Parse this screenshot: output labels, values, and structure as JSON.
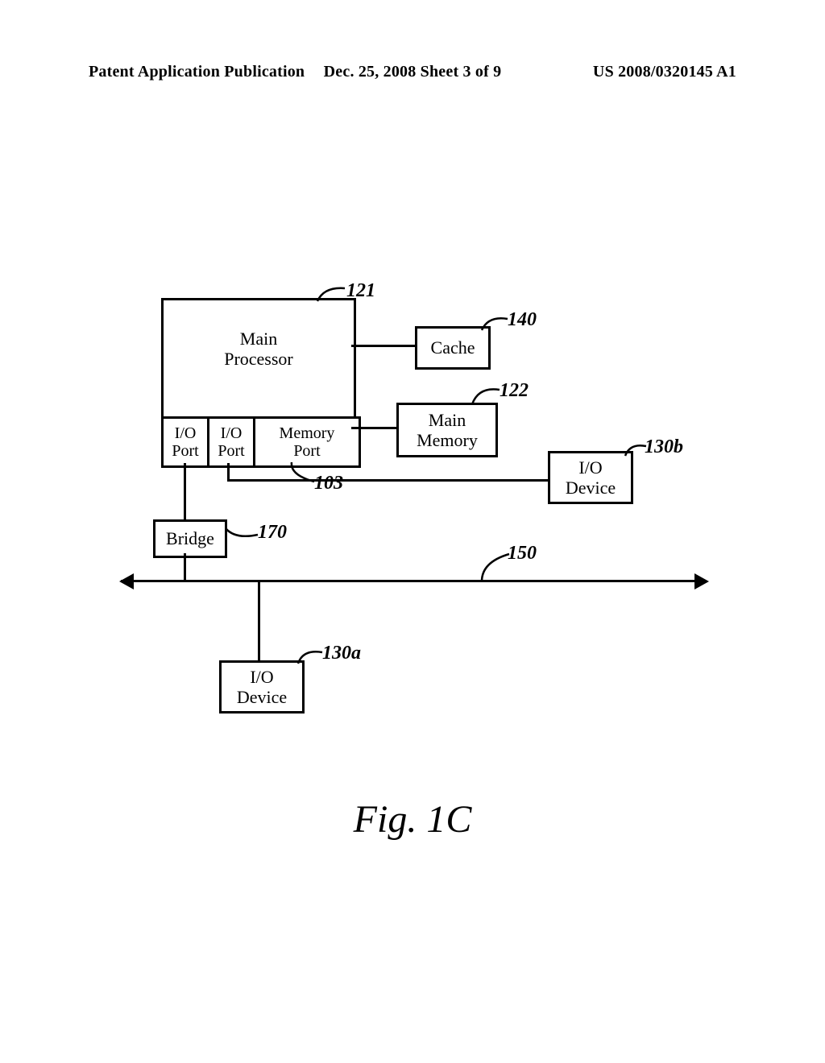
{
  "header": {
    "left": "Patent Application Publication",
    "center": "Dec. 25, 2008  Sheet 3 of 9",
    "right": "US 2008/0320145 A1"
  },
  "figure_caption": "Fig. 1C",
  "blocks": {
    "main_processor": "Main\nProcessor",
    "io_port_1": "I/O\nPort",
    "io_port_2": "I/O\nPort",
    "memory_port": "Memory\nPort",
    "cache": "Cache",
    "main_memory": "Main\nMemory",
    "io_device_a": "I/O\nDevice",
    "io_device_b": "I/O\nDevice",
    "bridge": "Bridge"
  },
  "callouts": {
    "c121": "121",
    "c140": "140",
    "c122": "122",
    "c130b": "130b",
    "c103": "103",
    "c170": "170",
    "c150": "150",
    "c130a": "130a"
  }
}
